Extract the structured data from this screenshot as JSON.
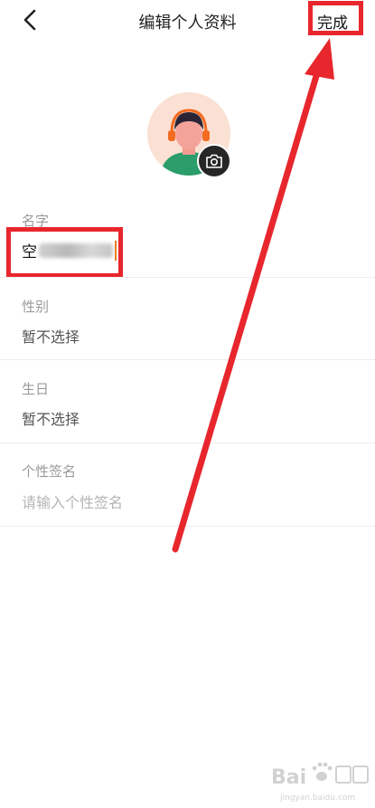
{
  "header": {
    "title": "编辑个人资料",
    "done_label": "完成"
  },
  "fields": {
    "name": {
      "label": "名字",
      "value_visible": "空"
    },
    "gender": {
      "label": "性别",
      "value": "暂不选择"
    },
    "birthday": {
      "label": "生日",
      "value": "暂不选择"
    },
    "signature": {
      "label": "个性签名",
      "placeholder": "请输入个性签名"
    }
  },
  "icons": [
    "back-icon",
    "camera-icon"
  ],
  "colors": {
    "highlight": "#e8262d",
    "caret": "#f07a1a",
    "label_gray": "#9a9a9a"
  },
  "watermark": {
    "brand": "Bai",
    "sub": "jingyan.baidu.com"
  }
}
